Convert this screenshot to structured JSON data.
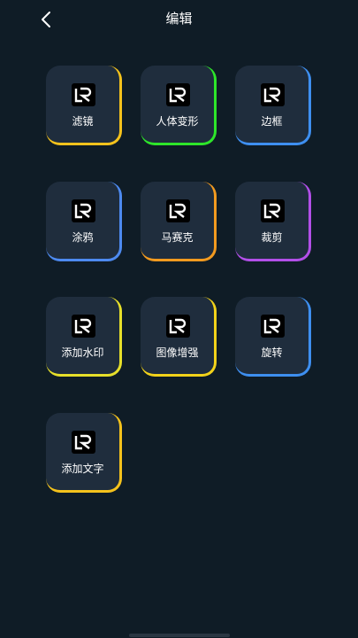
{
  "header": {
    "title": "编辑",
    "back_icon": "chevron-left-icon"
  },
  "tiles": [
    {
      "label": "滤镜",
      "accent": "#f4c21c",
      "icon": "lr-logo-icon"
    },
    {
      "label": "人体变形",
      "accent": "#2ee52a",
      "icon": "lr-logo-icon"
    },
    {
      "label": "边框",
      "accent": "#3e8ff0",
      "icon": "lr-logo-icon"
    },
    {
      "label": "涂鸦",
      "accent": "#4d8af0",
      "icon": "lr-logo-icon"
    },
    {
      "label": "马赛克",
      "accent": "#f29a1f",
      "icon": "lr-logo-icon"
    },
    {
      "label": "裁剪",
      "accent": "#b24fe8",
      "icon": "lr-logo-icon"
    },
    {
      "label": "添加水印",
      "accent": "#e6df2a",
      "icon": "lr-logo-icon"
    },
    {
      "label": "图像增强",
      "accent": "#f2d21a",
      "icon": "lr-logo-icon"
    },
    {
      "label": "旋转",
      "accent": "#3e8ff0",
      "icon": "lr-logo-icon"
    },
    {
      "label": "添加文字",
      "accent": "#f4c21c",
      "icon": "lr-logo-icon"
    }
  ]
}
